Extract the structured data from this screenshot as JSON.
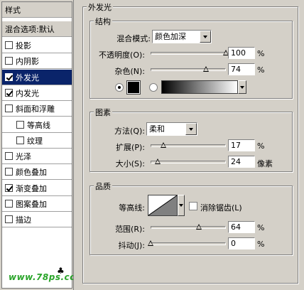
{
  "sidebar": {
    "header": "样式",
    "blend_label": "混合选项:默认",
    "items": [
      {
        "label": "投影",
        "checked": false,
        "selected": false,
        "indent": false
      },
      {
        "label": "内阴影",
        "checked": false,
        "selected": false,
        "indent": false
      },
      {
        "label": "外发光",
        "checked": true,
        "selected": true,
        "indent": false
      },
      {
        "label": "内发光",
        "checked": true,
        "selected": false,
        "indent": false
      },
      {
        "label": "斜面和浮雕",
        "checked": false,
        "selected": false,
        "indent": false
      },
      {
        "label": "等高线",
        "checked": false,
        "selected": false,
        "indent": true
      },
      {
        "label": "纹理",
        "checked": false,
        "selected": false,
        "indent": true
      },
      {
        "label": "光泽",
        "checked": false,
        "selected": false,
        "indent": false
      },
      {
        "label": "颜色叠加",
        "checked": false,
        "selected": false,
        "indent": false
      },
      {
        "label": "渐变叠加",
        "checked": true,
        "selected": false,
        "indent": false
      },
      {
        "label": "图案叠加",
        "checked": false,
        "selected": false,
        "indent": false
      },
      {
        "label": "描边",
        "checked": false,
        "selected": false,
        "indent": false
      }
    ],
    "watermark": "www.78ps.com"
  },
  "outer_glow": {
    "title": "外发光",
    "structure": {
      "title": "结构",
      "blend_mode_label": "混合模式:",
      "blend_mode_value": "颜色加深",
      "opacity_label": "不透明度(O):",
      "opacity_value": "100",
      "opacity_unit": "%",
      "opacity_fraction": 1.0,
      "noise_label": "杂色(N):",
      "noise_value": "74",
      "noise_unit": "%",
      "noise_fraction": 0.74
    },
    "elements": {
      "title": "图素",
      "method_label": "方法(Q):",
      "method_value": "柔和",
      "spread_label": "扩展(P):",
      "spread_value": "17",
      "spread_unit": "%",
      "spread_fraction": 0.17,
      "size_label": "大小(S):",
      "size_value": "24",
      "size_unit": "像素",
      "size_fraction": 0.096
    },
    "quality": {
      "title": "品质",
      "contour_label": "等高线:",
      "antialias_label": "消除锯齿(L)",
      "range_label": "范围(R):",
      "range_value": "64",
      "range_unit": "%",
      "range_fraction": 0.64,
      "jitter_label": "抖动(J):",
      "jitter_value": "0",
      "jitter_unit": "%",
      "jitter_fraction": 0.0
    }
  },
  "icons": {
    "color_swatch": "color-swatch-icon",
    "gradient": "gradient-icon",
    "contour": "contour-curve-icon",
    "dropdown": "chevron-down-icon"
  },
  "colors": {
    "glow_color": "#000000",
    "selection": "#0a246a",
    "watermark": "#2aa52a"
  }
}
